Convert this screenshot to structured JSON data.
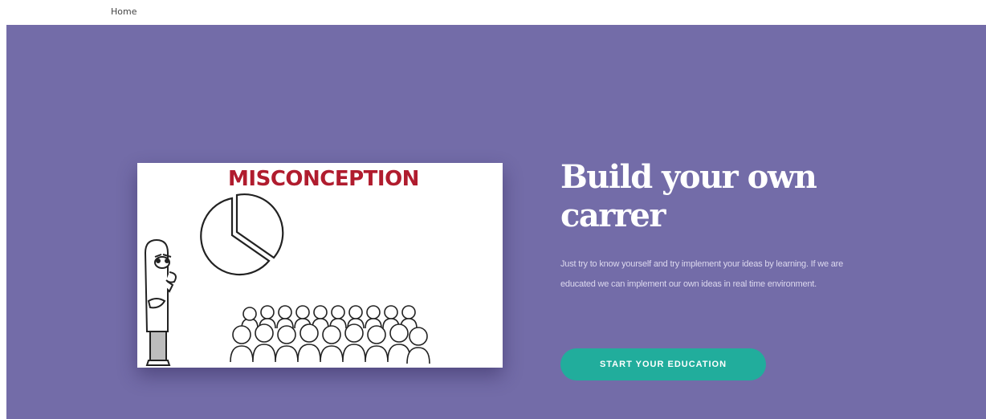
{
  "nav": {
    "home_label": "Home"
  },
  "hero": {
    "title_line1": "Build your own",
    "title_line2": "carrer",
    "description": "Just try to know yourself and try implement your ideas by learning. If we are educated we can implement our own ideas in real time environment.",
    "cta_label": "START YOUR EDUCATION",
    "background_color": "#736ca8",
    "cta_color": "#21ad9c"
  },
  "media": {
    "heading": "MISCONCEPTION",
    "heading_color": "#b01c2e",
    "icons": [
      "pie-chart-icon",
      "presenter-figure-icon",
      "audience-crowd-icon"
    ]
  }
}
